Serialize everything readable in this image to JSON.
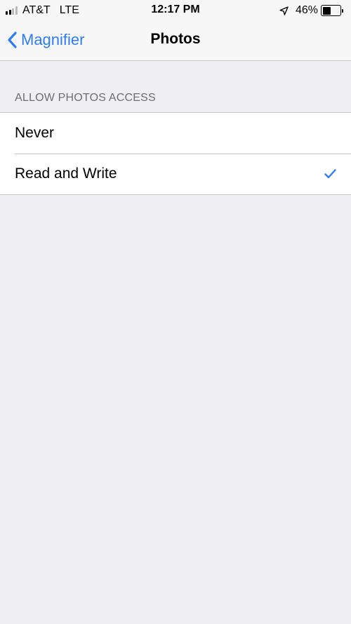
{
  "status_bar": {
    "carrier": "AT&T",
    "network": "LTE",
    "time": "12:17 PM",
    "battery_percent": "46%",
    "battery_level": 0.46,
    "signal_bars_filled": 2,
    "signal_bars_total": 4,
    "icons": [
      "signal-icon",
      "location-arrow-icon",
      "battery-icon"
    ]
  },
  "nav": {
    "back_label": "Magnifier",
    "back_icon": "chevron-left-icon",
    "title": "Photos"
  },
  "section": {
    "header": "ALLOW PHOTOS ACCESS",
    "options": [
      {
        "label": "Never",
        "selected": false
      },
      {
        "label": "Read and Write",
        "selected": true
      }
    ],
    "checkmark_icon": "checkmark-icon"
  },
  "colors": {
    "accent": "#2f7cf6",
    "background": "#efeff4",
    "bar_background": "#f7f7f7",
    "separator": "#c8c7cc",
    "section_header": "#6d6d72"
  }
}
